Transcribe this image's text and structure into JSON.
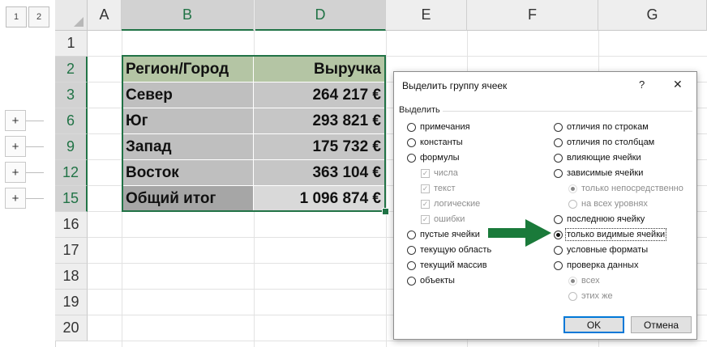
{
  "outline": {
    "levels": [
      "1",
      "2"
    ],
    "expand_buttons": [
      "+",
      "+",
      "+",
      "+"
    ]
  },
  "columns": [
    "A",
    "B",
    "C",
    "D",
    "E",
    "F",
    "G"
  ],
  "rows": [
    "1",
    "2",
    "3",
    "6",
    "9",
    "12",
    "15",
    "16",
    "17",
    "18",
    "19",
    "20"
  ],
  "table": {
    "header": [
      "Регион/Город",
      "Выручка"
    ],
    "rows": [
      [
        "Север",
        "264 217 €"
      ],
      [
        "Юг",
        "293 821 €"
      ],
      [
        "Запад",
        "175 732 €"
      ],
      [
        "Восток",
        "363 104 €"
      ]
    ],
    "total": [
      "Общий итог",
      "1 096 874 €"
    ]
  },
  "colors": {
    "header_fill": "#b4c5a4",
    "row_fill": "#bfbfbf",
    "row_fill_value": "#c6c6c6",
    "total_label_fill": "#a6a6a6",
    "total_value_fill": "#d9d9d9",
    "selection": "#217346",
    "arrow": "#1a7a3a"
  },
  "dialog": {
    "title": "Выделить группу ячеек",
    "help": "?",
    "close": "✕",
    "group_label": "Выделить",
    "left_options": [
      {
        "label": "примечания",
        "selected": false
      },
      {
        "label": "константы",
        "selected": false
      },
      {
        "label": "формулы",
        "selected": false
      }
    ],
    "formula_checks": [
      "числа",
      "текст",
      "логические",
      "ошибки"
    ],
    "left_options_2": [
      {
        "label": "пустые ячейки",
        "selected": false
      },
      {
        "label": "текущую область",
        "selected": false
      },
      {
        "label": "текущий массив",
        "selected": false
      },
      {
        "label": "объекты",
        "selected": false
      }
    ],
    "right_options": [
      {
        "label": "отличия по строкам",
        "selected": false
      },
      {
        "label": "отличия по столбцам",
        "selected": false
      },
      {
        "label": "влияющие ячейки",
        "selected": false
      },
      {
        "label": "зависимые ячейки",
        "selected": false
      }
    ],
    "dependents_sub": [
      "только непосредственно",
      "на всех уровнях"
    ],
    "right_options_2": [
      {
        "label": "последнюю ячейку",
        "selected": false
      },
      {
        "label": "только видимые ячейки",
        "selected": true
      },
      {
        "label": "условные форматы",
        "selected": false
      },
      {
        "label": "проверка данных",
        "selected": false
      }
    ],
    "validation_sub": [
      "всех",
      "этих же"
    ],
    "ok": "OK",
    "cancel": "Отмена"
  }
}
